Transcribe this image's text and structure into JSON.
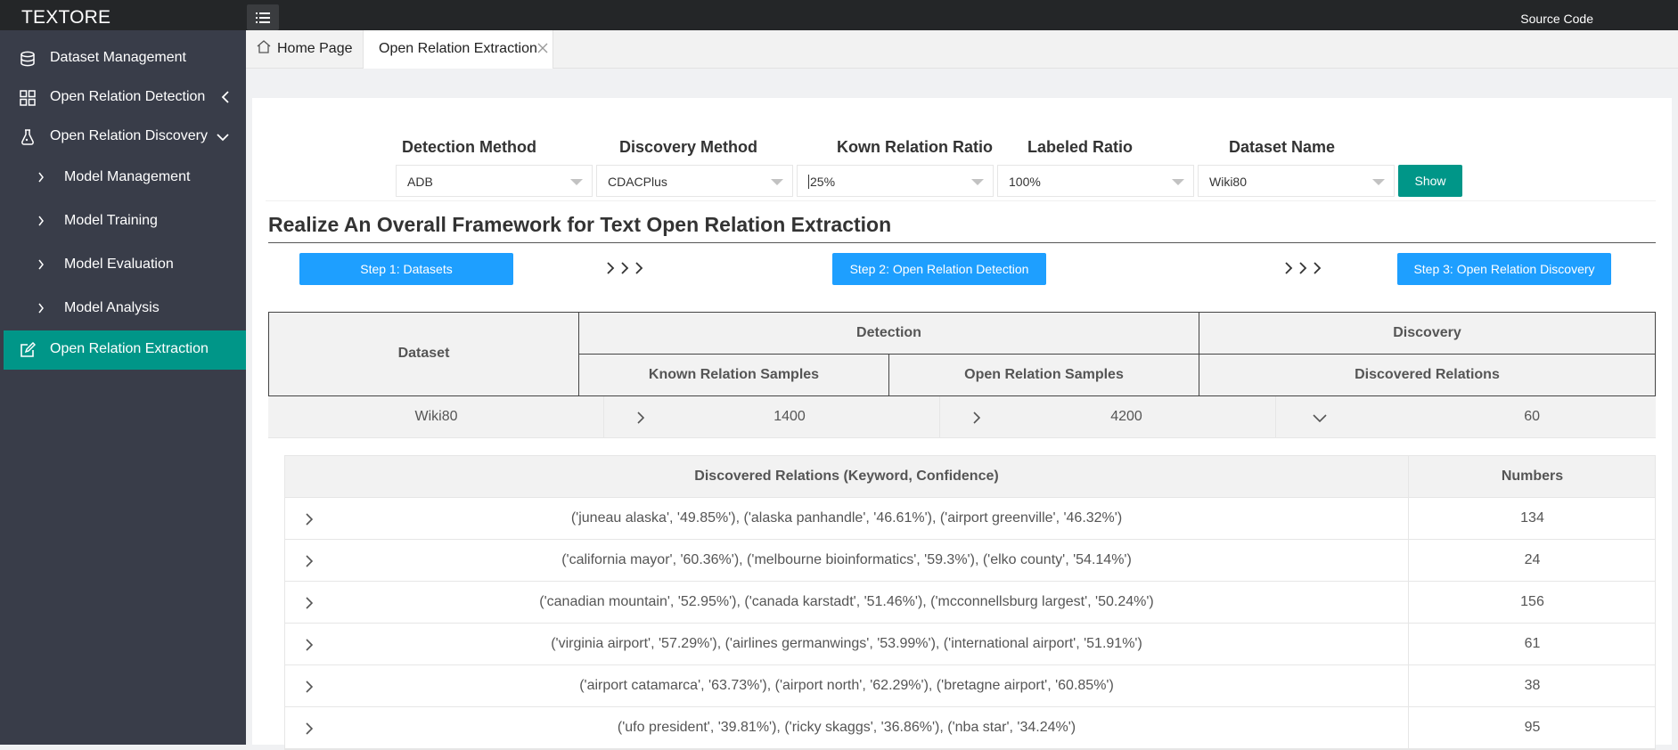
{
  "app": {
    "brand": "TEXTORE",
    "source_code_link": "Source Code",
    "menu_icon": "hamburger-icon"
  },
  "sidebar": {
    "items": [
      {
        "label": "Dataset Management",
        "icon": "database-icon"
      },
      {
        "label": "Open Relation Detection",
        "icon": "grid-icon",
        "arrow": "chevron-left-icon"
      },
      {
        "label": "Open Relation Discovery",
        "icon": "flask-icon",
        "arrow": "chevron-down-icon"
      },
      {
        "label": "Model Management",
        "sub": true
      },
      {
        "label": "Model Training",
        "sub": true
      },
      {
        "label": "Model Evaluation",
        "sub": true
      },
      {
        "label": "Model Analysis",
        "sub": true
      },
      {
        "label": "Open Relation Extraction",
        "icon": "edit-icon",
        "active": true
      }
    ]
  },
  "tabs": [
    {
      "label": "Home Page",
      "icon": "home-icon"
    },
    {
      "label": "Open Relation Extraction",
      "active": true,
      "close_icon": "close-icon"
    }
  ],
  "filters": {
    "detection": {
      "label": "Detection Method",
      "value": "ADB"
    },
    "discovery": {
      "label": "Discovery Method",
      "value": "CDACPlus"
    },
    "known_ratio": {
      "label": "Kown Relation Ratio",
      "value": "25%"
    },
    "labeled_ratio": {
      "label": "Labeled Ratio",
      "value": "100%"
    },
    "dataset": {
      "label": "Dataset Name",
      "value": "Wiki80"
    },
    "show_label": "Show"
  },
  "heading": "Realize An Overall Framework for Text Open Relation Extraction",
  "steps": {
    "step1": "Step 1: Datasets",
    "step2": "Step 2: Open Relation Detection",
    "step3": "Step 3: Open Relation Discovery"
  },
  "summary_table": {
    "headers": {
      "dataset": "Dataset",
      "detection": "Detection",
      "discovery": "Discovery",
      "known": "Known Relation Samples",
      "open": "Open Relation Samples",
      "discovered": "Discovered Relations"
    },
    "row": {
      "dataset": "Wiki80",
      "known": "1400",
      "open": "4200",
      "discovered": "60"
    }
  },
  "relations_table": {
    "headers": {
      "relations": "Discovered Relations (Keyword, Confidence)",
      "numbers": "Numbers"
    },
    "rows": [
      {
        "keywords": "('juneau alaska', '49.85%'), ('alaska panhandle', '46.61%'), ('airport greenville', '46.32%')",
        "number": "134"
      },
      {
        "keywords": "('california mayor', '60.36%'), ('melbourne bioinformatics', '59.3%'), ('elko county', '54.14%')",
        "number": "24"
      },
      {
        "keywords": "('canadian mountain', '52.95%'), ('canada karstadt', '51.46%'), ('mcconnellsburg largest', '50.24%')",
        "number": "156"
      },
      {
        "keywords": "('virginia airport', '57.29%'), ('airlines germanwings', '53.99%'), ('international airport', '51.91%')",
        "number": "61"
      },
      {
        "keywords": "('airport catamarca', '63.73%'), ('airport north', '62.29%'), ('bretagne airport', '60.85%')",
        "number": "38"
      },
      {
        "keywords": "('ufo president', '39.81%'), ('ricky skaggs', '36.86%'), ('nba star', '34.24%')",
        "number": "95"
      }
    ]
  },
  "colors": {
    "accent": "#009688",
    "primary_button": "#1e9fff",
    "sidebar": "#393d49",
    "topbar": "#242628"
  }
}
